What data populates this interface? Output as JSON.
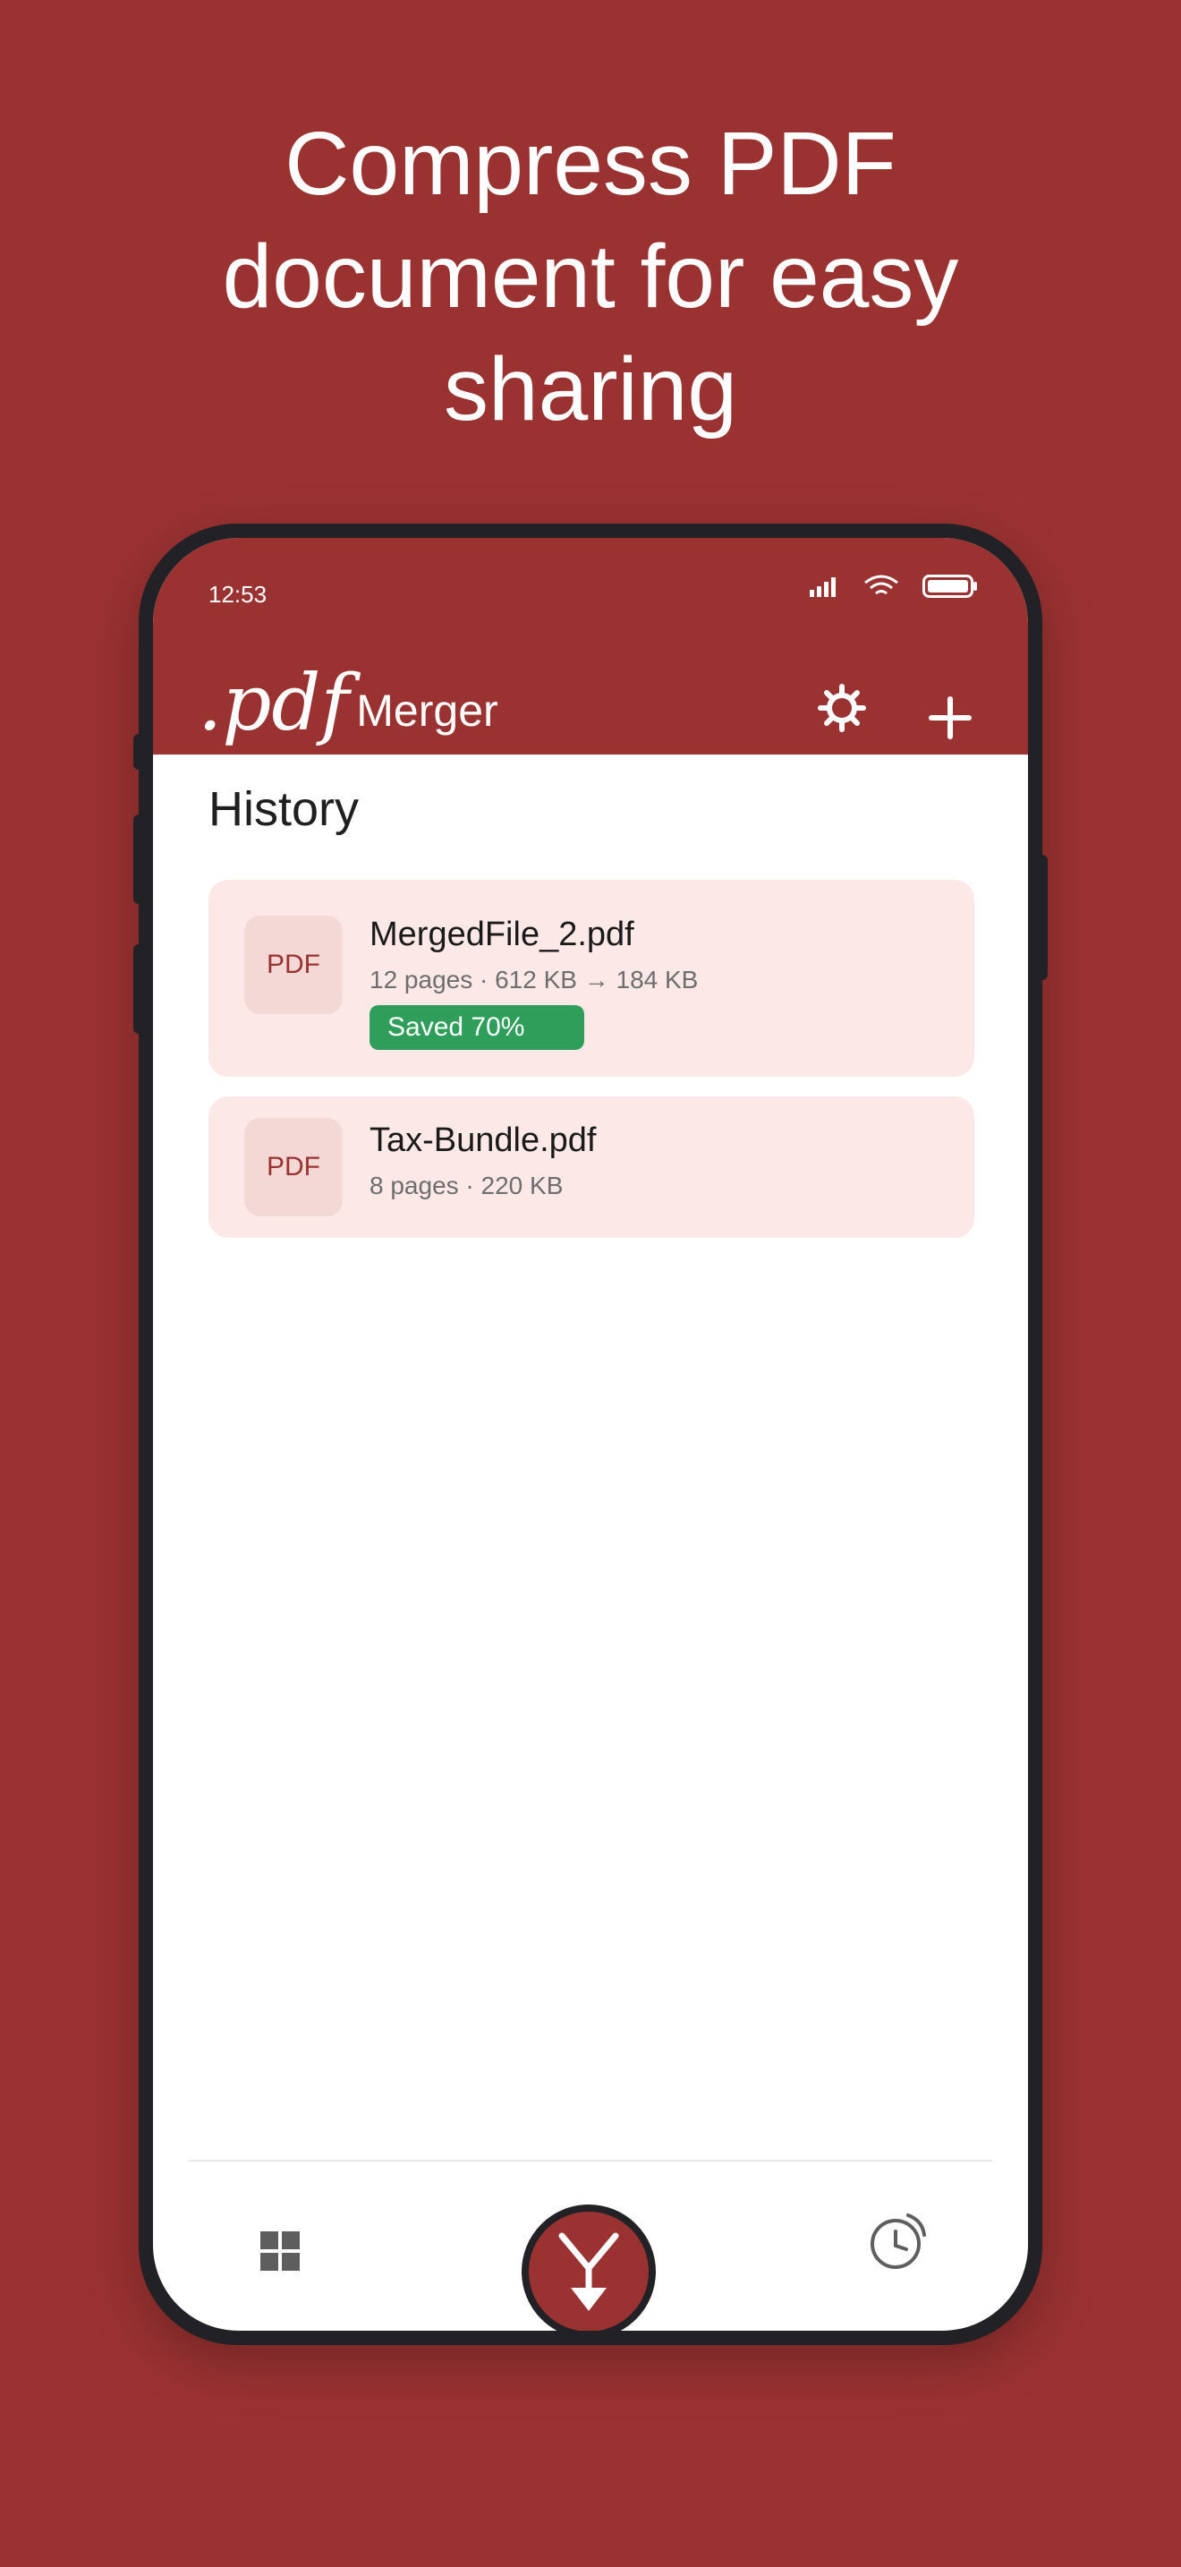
{
  "headline": {
    "line1": "Compress PDF",
    "line2": "document for easy",
    "line3": "sharing"
  },
  "status_bar": {
    "time": "12:53",
    "icons": [
      "signal-icon",
      "wifi-icon",
      "battery-icon"
    ]
  },
  "app_bar": {
    "brand_pdf": ".pdf",
    "brand_name": "Merger",
    "actions": [
      "gear-icon",
      "plus-icon"
    ]
  },
  "history": {
    "title": "History",
    "items": [
      {
        "thumb_label": "PDF",
        "name": "MergedFile_2.pdf",
        "meta": "12 pages · 612 KB → 184 KB",
        "badge": "Saved 70%"
      },
      {
        "thumb_label": "PDF",
        "name": "Tax-Bundle.pdf",
        "meta": "8 pages · 220 KB"
      }
    ]
  },
  "bottom_nav": {
    "left": "grid-icon",
    "center": "merge-icon",
    "right": "history-icon"
  },
  "colors": {
    "brand": "#9b3232",
    "card_bg": "#fce9e7",
    "badge_green": "#2f9e5a"
  }
}
